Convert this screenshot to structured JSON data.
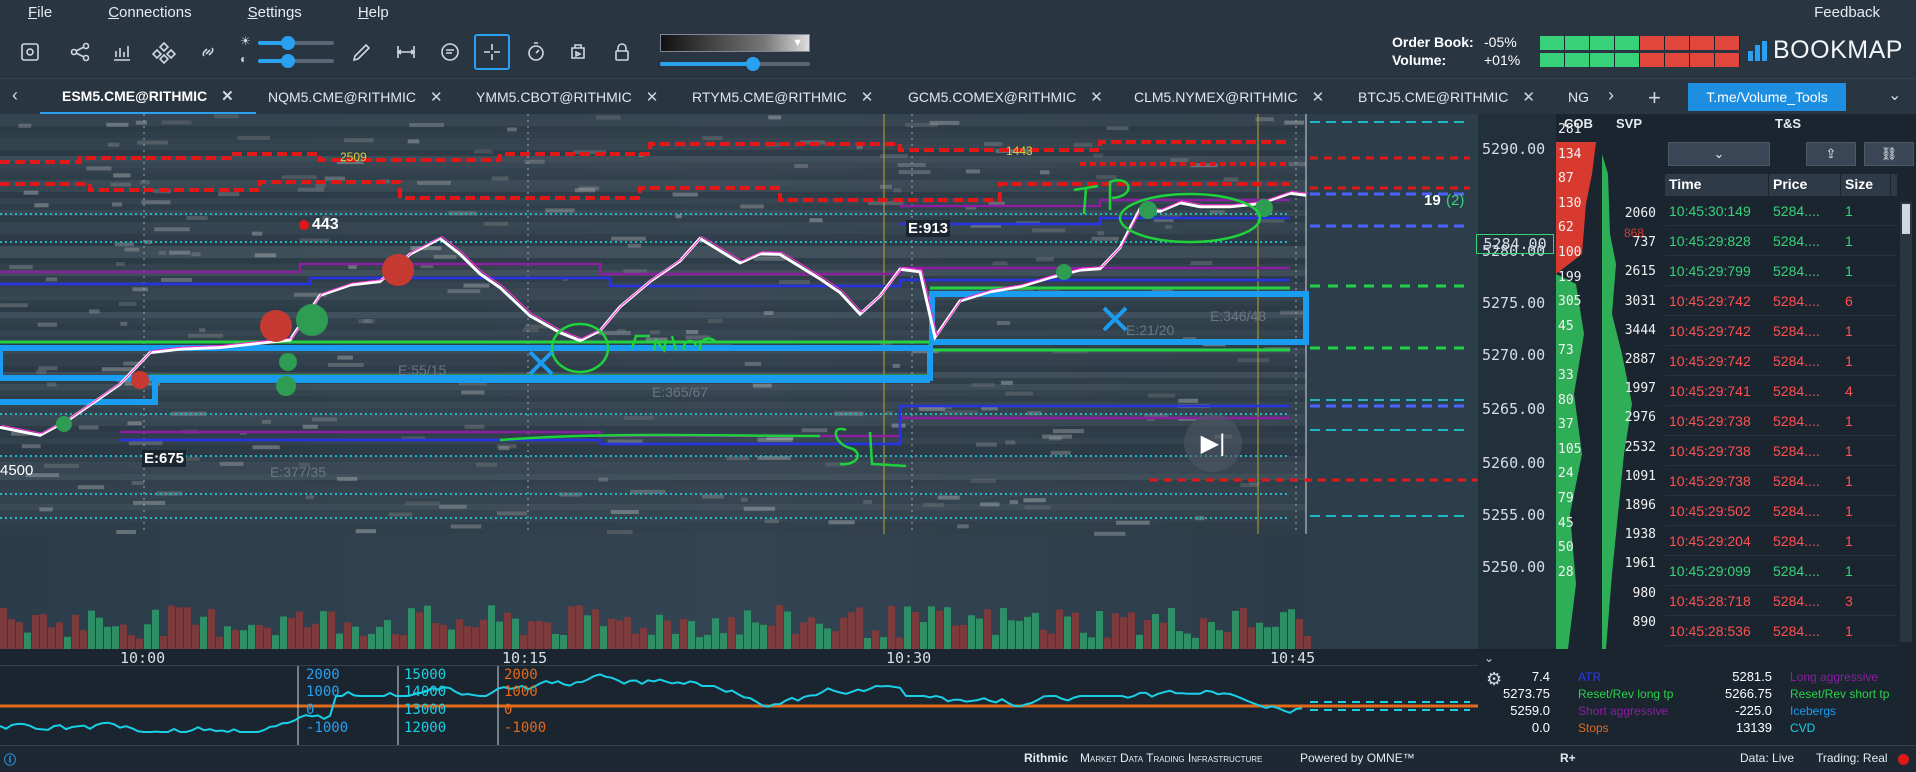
{
  "menu": {
    "items": [
      "File",
      "Connections",
      "Settings",
      "Help"
    ],
    "feedback": "Feedback"
  },
  "toolbar": {
    "tools": [
      "screenshot-icon",
      "share-icon",
      "indicators-icon",
      "widgets-icon",
      "link-icon",
      "pencil-icon",
      "ruler-icon",
      "chat-icon",
      "crosshair-icon",
      "stopwatch-icon",
      "replay-icon",
      "lock-icon"
    ],
    "brightness": 0.4,
    "contrast": 0.4,
    "gradient_level": 0.62
  },
  "orderbook": {
    "label": "Order Book:",
    "value": "-05%",
    "volume_label": "Volume:",
    "volume_value": "+01%",
    "ob_buy_fraction": 0.48,
    "vol_buy_fraction": 0.5
  },
  "brand": {
    "logo_text": "BOOKMAP",
    "accent": "#2aa1f0"
  },
  "tabs": [
    {
      "label": "ESM5.CME@RITHMIC",
      "active": true
    },
    {
      "label": "NQM5.CME@RITHMIC"
    },
    {
      "label": "YMM5.CBOT@RITHMIC"
    },
    {
      "label": "RTYM5.CME@RITHMIC"
    },
    {
      "label": "GCM5.COMEX@RITHMIC"
    },
    {
      "label": "CLM5.NYMEX@RITHMIC"
    },
    {
      "label": "BTCJ5.CME@RITHMIC"
    },
    {
      "label": "NG"
    }
  ],
  "tab_link": "T.me/Volume_Tools",
  "chart": {
    "price_ticks": [
      "5290.00",
      "5284.00",
      "5280.00",
      "5275.00",
      "5270.00",
      "5265.00",
      "5260.00",
      "5255.00",
      "5250.00"
    ],
    "current_price": "5284.00",
    "time_ticks": [
      "10:00",
      "10:15",
      "10:30",
      "10:45"
    ],
    "annotations": {
      "entry1": "E:675",
      "entry2": "E:913",
      "dot_label": "443",
      "size_label": "19",
      "size_label2": "(2)",
      "left_price": "4500",
      "small1": "2509",
      "small2": "1443",
      "faded1": "E:377/35",
      "faded2": "E:365/67",
      "faded3": "E:55/15",
      "faded4": "E:346/48",
      "faded5": "E:21/20"
    },
    "handwriting": {
      "entry": "Enter",
      "tp": "TP",
      "sl": "SL"
    }
  },
  "cob": {
    "header": "COB",
    "values": [
      "281",
      "134",
      "87",
      "130",
      "62",
      "100",
      "199",
      "305",
      "45",
      "73",
      "33",
      "80",
      "37",
      "105",
      "24",
      "79",
      "45",
      "50",
      "28"
    ]
  },
  "svp": {
    "header": "SVP",
    "values": [
      "2060",
      "737",
      "2615",
      "3031",
      "3444",
      "2887",
      "1997",
      "2976",
      "2532",
      "1091",
      "1896",
      "1938",
      "1961",
      "980",
      "890"
    ],
    "top_label": "868"
  },
  "ts": {
    "title": "T&S",
    "columns": [
      "Time",
      "Price",
      "Size"
    ],
    "rows": [
      {
        "time": "10:45:30:149",
        "price": "5284....",
        "size": "1",
        "side": "buy"
      },
      {
        "time": "10:45:29:828",
        "price": "5284....",
        "size": "1",
        "side": "buy"
      },
      {
        "time": "10:45:29:799",
        "price": "5284....",
        "size": "1",
        "side": "buy"
      },
      {
        "time": "10:45:29:742",
        "price": "5284....",
        "size": "6",
        "side": "sell"
      },
      {
        "time": "10:45:29:742",
        "price": "5284....",
        "size": "1",
        "side": "sell"
      },
      {
        "time": "10:45:29:742",
        "price": "5284....",
        "size": "1",
        "side": "sell"
      },
      {
        "time": "10:45:29:741",
        "price": "5284....",
        "size": "4",
        "side": "sell"
      },
      {
        "time": "10:45:29:738",
        "price": "5284....",
        "size": "1",
        "side": "sell"
      },
      {
        "time": "10:45:29:738",
        "price": "5284....",
        "size": "1",
        "side": "sell"
      },
      {
        "time": "10:45:29:738",
        "price": "5284....",
        "size": "1",
        "side": "sell"
      },
      {
        "time": "10:45:29:502",
        "price": "5284....",
        "size": "1",
        "side": "sell"
      },
      {
        "time": "10:45:29:204",
        "price": "5284....",
        "size": "1",
        "side": "sell"
      },
      {
        "time": "10:45:29:099",
        "price": "5284....",
        "size": "1",
        "side": "buy"
      },
      {
        "time": "10:45:28:718",
        "price": "5284....",
        "size": "3",
        "side": "sell"
      },
      {
        "time": "10:45:28:536",
        "price": "5284....",
        "size": "1",
        "side": "sell"
      }
    ]
  },
  "indicator": {
    "scale_a": [
      "2000",
      "1000",
      "0",
      "-1000"
    ],
    "scale_b": [
      "15000",
      "14000",
      "13000",
      "12000"
    ],
    "scale_c": [
      "2000",
      "1000",
      "0",
      "-1000"
    ]
  },
  "legend": {
    "values_left": [
      "7.4",
      "5273.75",
      "5259.0",
      "0.0"
    ],
    "labels_left": [
      "ATR",
      "Reset/Rev long tp",
      "Short aggressive",
      "Stops"
    ],
    "values_right": [
      "5281.5",
      "5266.75",
      "-225.0",
      "13139"
    ],
    "labels_right": [
      "Long aggressive",
      "Reset/Rev short tp",
      "Icebergs",
      "CVD"
    ]
  },
  "status": {
    "rithmic": "Rithmic",
    "tagline": "Market Data Trading Infrastructure",
    "powered": "Powered by OMNE™",
    "rplus": "R+",
    "data": "Data: Live",
    "trading": "Trading: Real"
  },
  "colors": {
    "up": "#38d27a",
    "down": "#ff5050",
    "accent": "#2aa1f0"
  }
}
